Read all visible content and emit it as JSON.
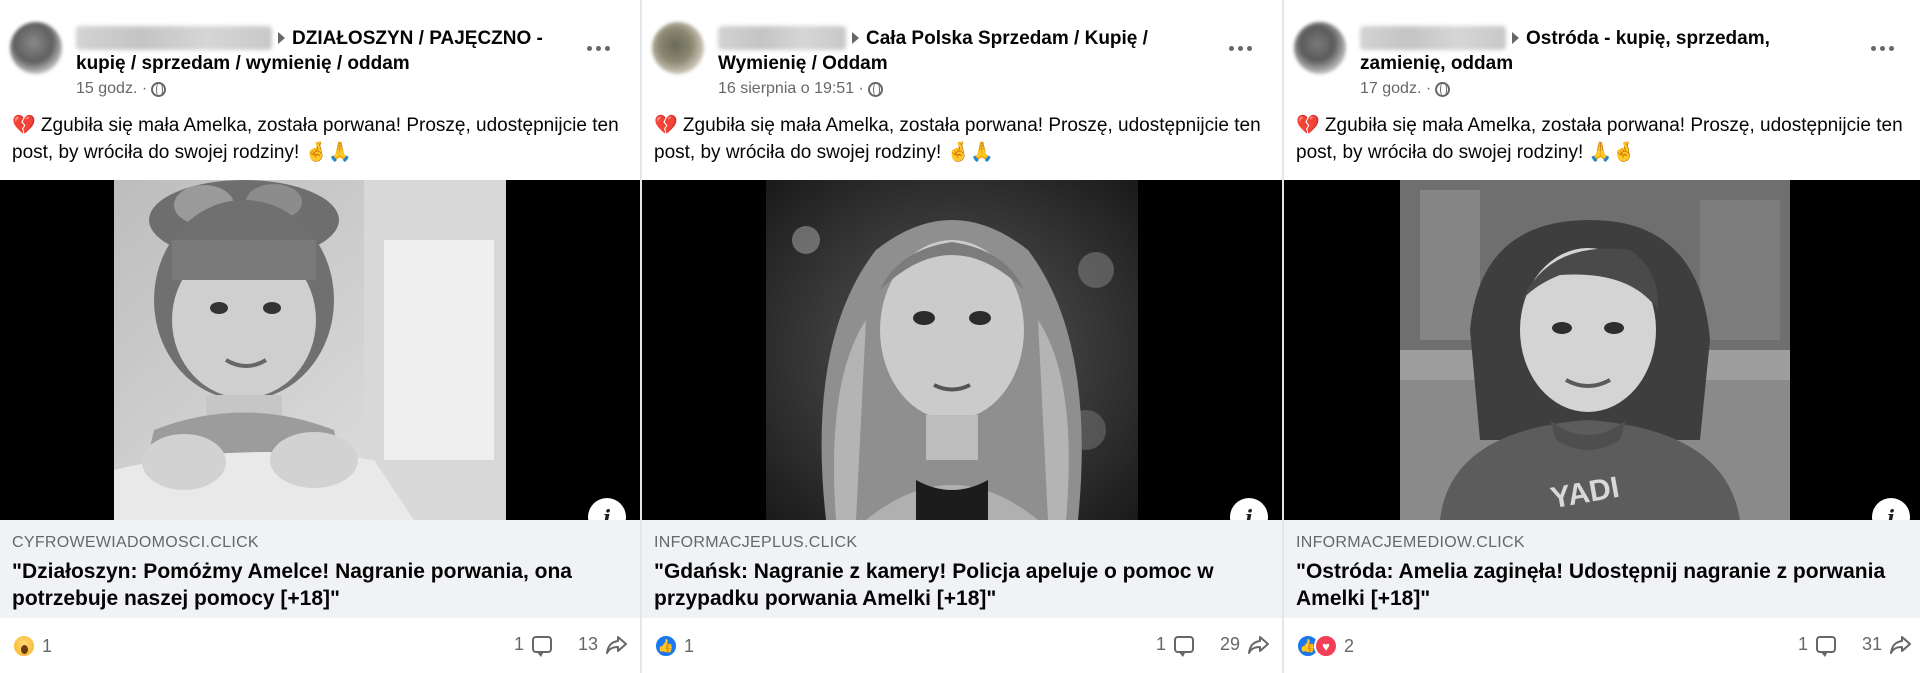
{
  "posts": [
    {
      "group": "DZIAŁOSZYN / PAJĘCZNO - kupię / sprzedam / wymienię / oddam",
      "time": "15 godz. ·",
      "text": "💔 Zgubiła się mała Amelka, została porwana! Proszę, udostępnijcie ten post, by wróciła do swojej rodziny! 🤞🙏",
      "domain": "CYFROWEWIADOMOSCI.CLICK",
      "headline": "\"Działoszyn: Pomóżmy Amelce! Nagranie porwania, ona potrzebuje naszej pomocy [+18]\"",
      "reaction_count": "1",
      "comments": "1",
      "shares": "13",
      "reactions": [
        "wow"
      ]
    },
    {
      "group": "Cała Polska Sprzedam / Kupię / Wymienię / Oddam",
      "time": "16 sierpnia o 19:51 ·",
      "text": "💔 Zgubiła się mała Amelka, została porwana! Proszę, udostępnijcie ten post, by wróciła do swojej rodziny! 🤞🙏",
      "domain": "INFORMACJEPLUS.CLICK",
      "headline": "\"Gdańsk: Nagranie z kamery! Policja apeluje o pomoc w przypadku porwania Amelki [+18]\"",
      "reaction_count": "1",
      "comments": "1",
      "shares": "29",
      "reactions": [
        "like"
      ]
    },
    {
      "group": "Ostróda - kupię, sprzedam, zamienię, oddam",
      "time": "17 godz. ·",
      "text": "💔 Zgubiła się mała Amelka, została porwana! Proszę, udostępnijcie ten post, by wróciła do swojej rodziny! 🙏🤞",
      "domain": "INFORMACJEMEDIOW.CLICK",
      "headline": "\"Ostróda: Amelia zaginęła! Udostępnij nagranie z porwania Amelki [+18]\"",
      "reaction_count": "2",
      "comments": "1",
      "shares": "31",
      "reactions": [
        "like",
        "love"
      ]
    }
  ],
  "colors": {
    "meta": "#65676b",
    "link_bg": "#f0f2f5",
    "like": "#1877f2",
    "love": "#f33e58"
  },
  "icons": [
    "arrow-icon",
    "globe-icon",
    "more-icon",
    "info-icon",
    "comment-icon",
    "share-icon",
    "wow-reaction-icon",
    "like-reaction-icon",
    "love-reaction-icon"
  ]
}
